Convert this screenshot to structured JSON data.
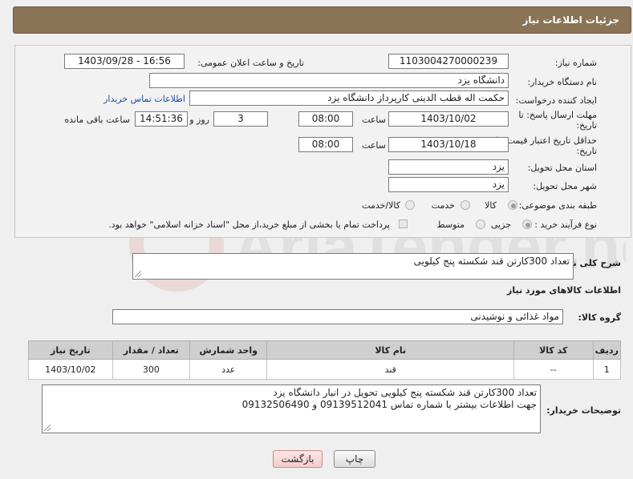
{
  "header": {
    "title": "جزئیات اطلاعات نیاز"
  },
  "form": {
    "need_number_label": "شماره نیاز:",
    "need_number": "1103004270000239",
    "announce_label": "تاریخ و ساعت اعلان عمومی:",
    "announce_value": "1403/09/28 - 16:56",
    "buyer_org_label": "نام دستگاه خریدار:",
    "buyer_org": "دانشگاه یزد",
    "creator_label": "ایجاد کننده درخواست:",
    "creator": "حکمت اله قطب الدینی کارپرداز دانشگاه یزد",
    "contact_link": "اطلاعات تماس خریدار",
    "reply_deadline_label_1": "مهلت ارسال پاسخ: تا",
    "reply_deadline_label_2": "تاریخ:",
    "reply_date": "1403/10/02",
    "time_label": "ساعت",
    "reply_time": "08:00",
    "days_value": "3",
    "days_label": "روز و",
    "remaining_value": "14:51:36",
    "remaining_label": "ساعت باقی مانده",
    "price_validity_label_1": "حداقل تاریخ اعتبار قیمت: تا",
    "price_validity_label_2": "تاریخ:",
    "price_date": "1403/10/18",
    "price_time": "08:00",
    "province_label": "استان محل تحویل:",
    "province": "یزد",
    "city_label": "شهر محل تحویل:",
    "city": "یزد",
    "category_label": "طبقه بندی موضوعی:",
    "category_options": [
      "کالا",
      "خدمت",
      "کالا/خدمت"
    ],
    "process_label": "نوع فرآیند خرید :",
    "process_options": [
      "جزیی",
      "متوسط"
    ],
    "process_note": "پرداخت تمام یا بخشی از مبلغ خرید،از محل \"اسناد خزانه اسلامی\" خواهد بود."
  },
  "description": {
    "label": "شرح کلی نیاز:",
    "value": "تعداد 300کارتن قند شکسته پنج کیلویی"
  },
  "goods": {
    "section_title": "اطلاعات کالاهای مورد نیاز",
    "group_label": "گروه کالا:",
    "group_value": "مواد غذائی و نوشیدنی",
    "columns": [
      "ردیف",
      "کد کالا",
      "نام کالا",
      "واحد شمارش",
      "تعداد / مقدار",
      "تاریخ نیاز"
    ],
    "rows": [
      [
        "1",
        "--",
        "قند",
        "عدد",
        "300",
        "1403/10/02"
      ]
    ]
  },
  "buyer_notes": {
    "label": "توضیحات خریدار:",
    "line1": "تعداد 300کارتن قند شکسته پنج کیلویی تحویل در انبار دانشگاه یزد",
    "line2": "جهت اطلاعات بیشتر با شماره تماس 09139512041 و 09132506490"
  },
  "buttons": {
    "print": "چاپ",
    "back": "بازگشت"
  },
  "watermark": {
    "text": "AriaTender.net"
  }
}
